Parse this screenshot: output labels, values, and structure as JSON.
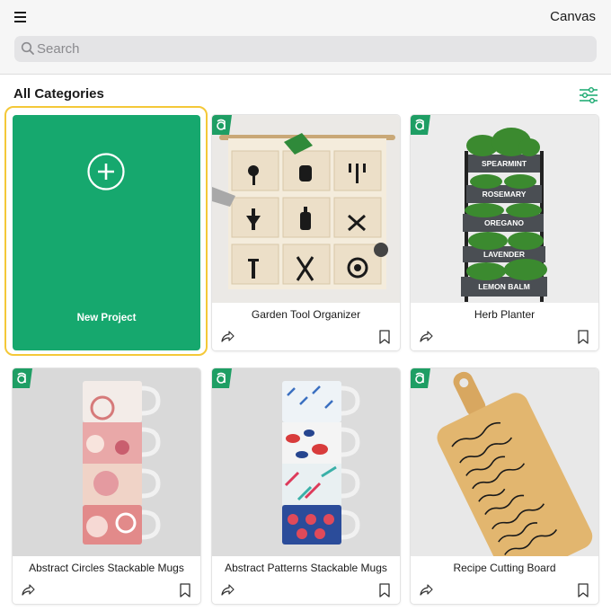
{
  "header": {
    "menu_icon": "hamburger-menu-icon",
    "canvas_label": "Canvas"
  },
  "search": {
    "placeholder": "Search",
    "value": ""
  },
  "section": {
    "title": "All Categories",
    "filter_icon": "sliders-icon"
  },
  "new_project": {
    "label": "New Project",
    "icon": "plus-circle-icon"
  },
  "projects": [
    {
      "title": "Garden Tool Organizer"
    },
    {
      "title": "Herb Planter",
      "shelf_labels": [
        "SPEARMINT",
        "ROSEMARY",
        "OREGANO",
        "LAVENDER",
        "LEMON BALM"
      ]
    },
    {
      "title": "Abstract Circles Stackable Mugs"
    },
    {
      "title": "Abstract Patterns Stackable Mugs"
    },
    {
      "title": "Recipe Cutting Board"
    }
  ],
  "colors": {
    "accent_green": "#16a86e",
    "selection_yellow": "#f4c838",
    "badge_green": "#1e9e64"
  }
}
